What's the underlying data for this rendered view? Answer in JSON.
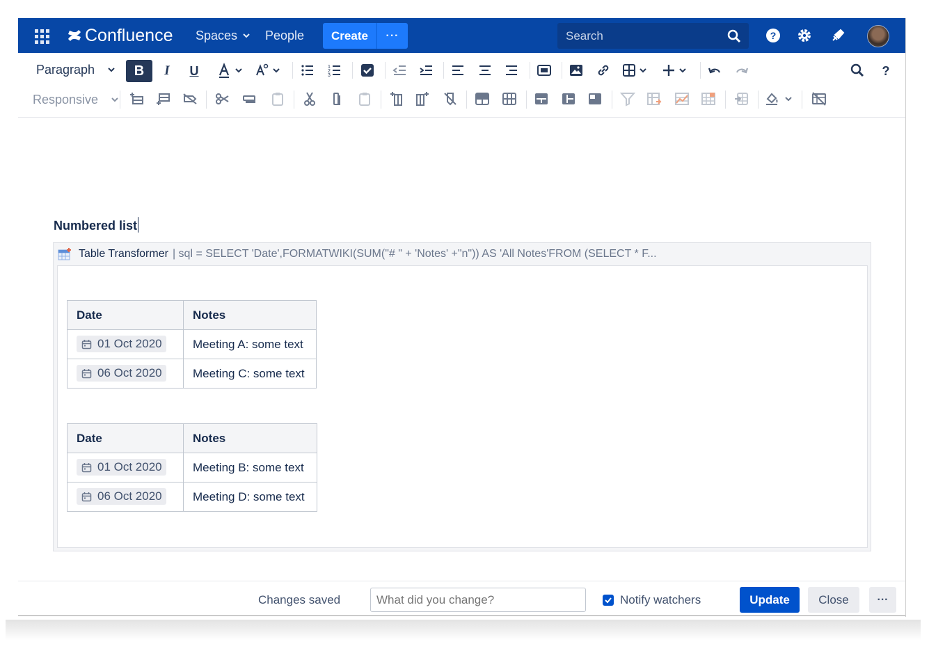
{
  "topbar": {
    "app_name": "Confluence",
    "nav": [
      {
        "label": "Spaces",
        "has_dropdown": true
      },
      {
        "label": "People",
        "has_dropdown": false
      }
    ],
    "create_label": "Create",
    "more_label": "···",
    "search_placeholder": "Search",
    "icons": [
      "app-switcher-icon",
      "help-icon",
      "settings-icon",
      "notifications-icon",
      "avatar"
    ]
  },
  "toolbar": {
    "paragraph_style": "Paragraph",
    "table_width": "Responsive",
    "bold_label": "B",
    "italic_label": "I",
    "underline_label": "U",
    "help_label": "?"
  },
  "content": {
    "heading": "Numbered list",
    "macro": {
      "name": "Table Transformer",
      "params": "| sql = SELECT 'Date',FORMATWIKI(SUM(\"# \" + 'Notes' +\"n\")) AS 'All Notes'FROM (SELECT * F..."
    },
    "tables": [
      {
        "headers": [
          "Date",
          "Notes"
        ],
        "rows": [
          {
            "date": "01 Oct 2020",
            "notes": "Meeting A: some text"
          },
          {
            "date": "06 Oct 2020",
            "notes": "Meeting C: some text"
          }
        ]
      },
      {
        "headers": [
          "Date",
          "Notes"
        ],
        "rows": [
          {
            "date": "01 Oct 2020",
            "notes": "Meeting B: some text"
          },
          {
            "date": "06 Oct 2020",
            "notes": "Meeting D: some text"
          }
        ]
      }
    ]
  },
  "footer": {
    "status": "Changes saved",
    "change_placeholder": "What did you change?",
    "notify_label": "Notify watchers",
    "notify_checked": true,
    "update_label": "Update",
    "close_label": "Close",
    "more_label": "···"
  },
  "colors": {
    "topbar": "#0747a6",
    "create": "#1d7afc",
    "primary": "#0052cc",
    "text": "#172b4d"
  }
}
